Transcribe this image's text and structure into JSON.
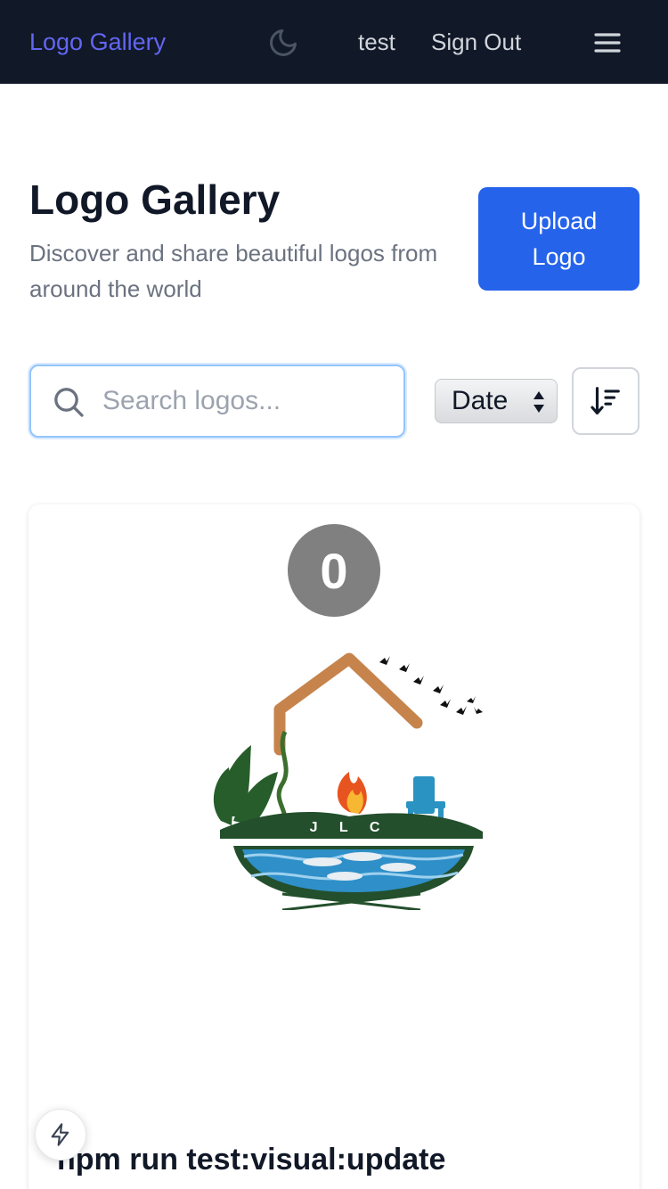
{
  "nav": {
    "brand": "Logo Gallery",
    "theme_icon": "moon-icon",
    "user": "test",
    "sign_out": "Sign Out",
    "menu_icon": "hamburger-menu-icon"
  },
  "header": {
    "title": "Logo Gallery",
    "subtitle": "Discover and share beautiful logos from around the world",
    "upload_label": "Upload Logo"
  },
  "controls": {
    "search_placeholder": "Search logos...",
    "search_value": "",
    "search_icon": "search-icon",
    "sort_selected": "Date",
    "sort_direction_icon": "sort-descending-icon"
  },
  "logos": [
    {
      "rank": "0",
      "title": "npm run test:visual:update",
      "image_letters": "J L C"
    }
  ],
  "dev_indicator_icon": "lightning-icon",
  "colors": {
    "nav_bg": "#111827",
    "brand": "#6366f1",
    "primary_button": "#2563eb",
    "badge": "#808080"
  }
}
